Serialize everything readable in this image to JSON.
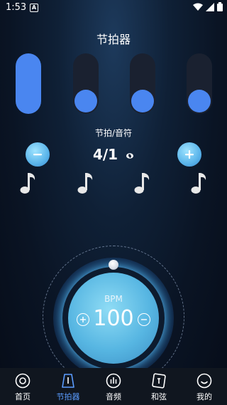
{
  "status": {
    "time": "1:53",
    "notification": "A"
  },
  "title": "节拍器",
  "beats": [
    {
      "state": "accent"
    },
    {
      "state": "normal"
    },
    {
      "state": "normal"
    },
    {
      "state": "normal"
    }
  ],
  "time_signature": {
    "label": "节拍/音符",
    "value": "4/1"
  },
  "bpm": {
    "label": "BPM",
    "value": "100"
  },
  "tabs": [
    {
      "label": "首页",
      "icon": "record-icon",
      "active": false
    },
    {
      "label": "节拍器",
      "icon": "metronome-icon",
      "active": true
    },
    {
      "label": "音频",
      "icon": "equalizer-icon",
      "active": false
    },
    {
      "label": "和弦",
      "icon": "chord-icon",
      "active": false
    },
    {
      "label": "我的",
      "icon": "smile-icon",
      "active": false
    }
  ],
  "colors": {
    "accent": "#4a86f0",
    "tab_active": "#5a9cff",
    "dial": "#57b6e2"
  }
}
